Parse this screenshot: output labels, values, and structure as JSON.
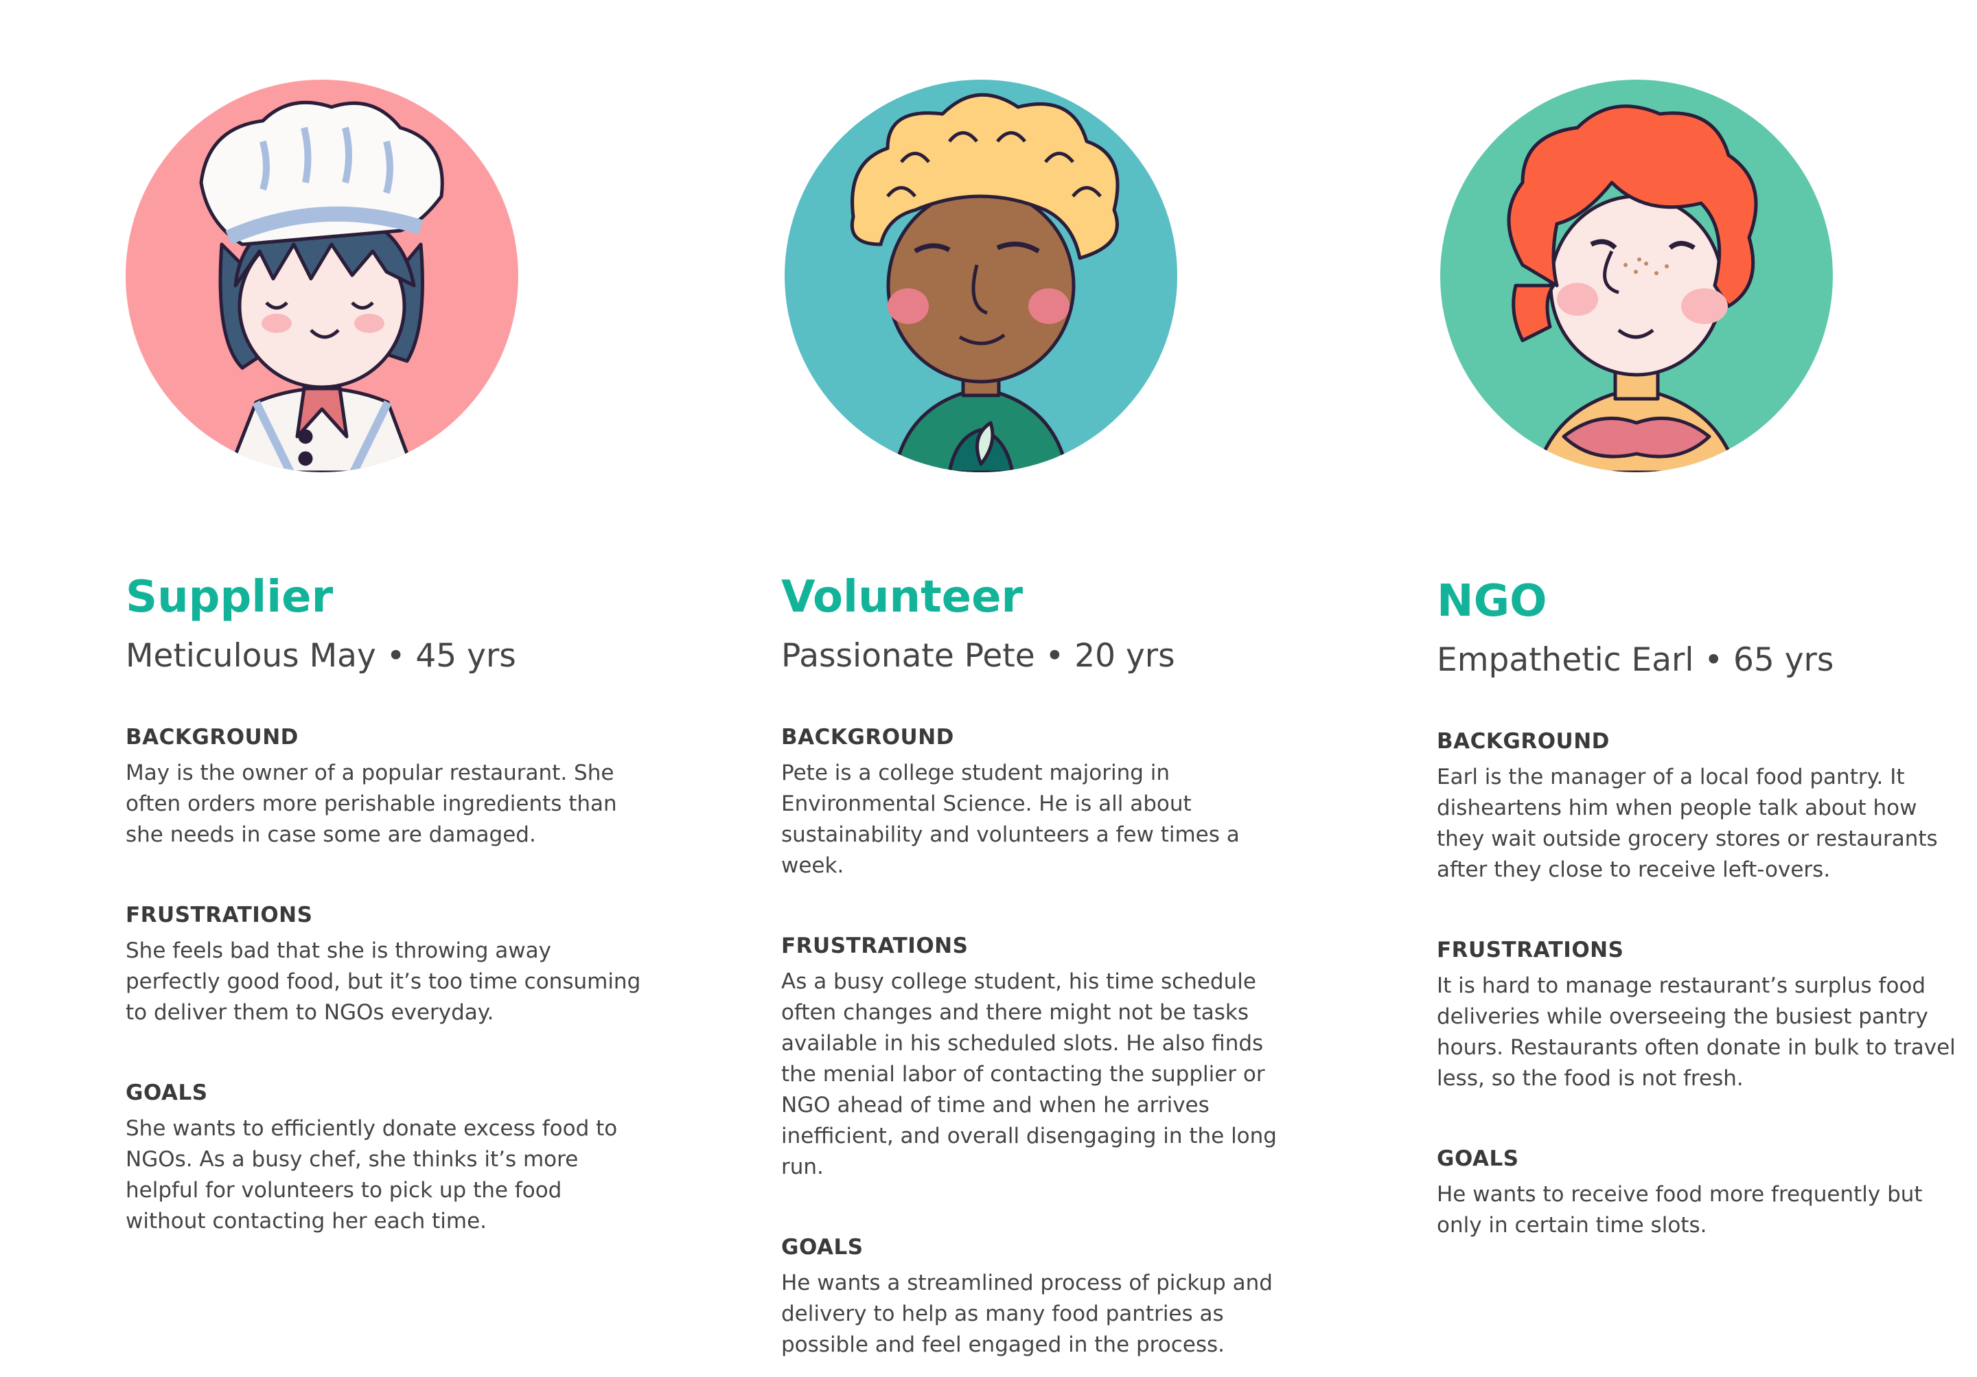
{
  "colors": {
    "accent": "#13b39a",
    "supplier_bg": "#fc9da2",
    "volunteer_bg": "#5abec5",
    "ngo_bg": "#5fc8aa",
    "body_text": "#444444",
    "outline": "#2a1e3a"
  },
  "personas": [
    {
      "role": "Supplier",
      "persona": "Meticulous May • 45 yrs",
      "avatar_icon": "chef-avatar-icon",
      "sections": [
        {
          "heading": "BACKGROUND",
          "text": "May is the owner of a popular restaurant. She often orders more perishable ingredients than she needs in case some are damaged."
        },
        {
          "heading": "FRUSTRATIONS",
          "text": "She feels bad that she is throwing away perfectly good food, but it’s too time consuming to deliver them to NGOs everyday."
        },
        {
          "heading": "GOALS",
          "text": "She wants to efficiently donate excess food to NGOs. As a busy chef, she thinks it’s more helpful for volunteers to pick up the food without contacting her each time."
        }
      ]
    },
    {
      "role": "Volunteer",
      "persona": "Passionate Pete • 20 yrs",
      "avatar_icon": "volunteer-avatar-icon",
      "sections": [
        {
          "heading": "BACKGROUND",
          "text": "Pete is a college student majoring in Environmental Science. He is all about sustainability and volunteers a few times a week."
        },
        {
          "heading": "FRUSTRATIONS",
          "text": "As a busy college student, his time schedule often changes and there might not be tasks available in his scheduled slots. He also finds the menial labor of contacting the supplier or NGO ahead of time and when he arrives inefficient, and overall disengaging in the long run."
        },
        {
          "heading": "GOALS",
          "text": "He wants a streamlined process of pickup and delivery to help as many food pantries as possible and feel engaged in the process."
        }
      ]
    },
    {
      "role": "NGO",
      "persona": "Empathetic Earl • 65 yrs",
      "avatar_icon": "ngo-avatar-icon",
      "sections": [
        {
          "heading": "BACKGROUND",
          "text": "Earl is the manager of a local food pantry. It disheartens him when people talk about how they wait outside grocery stores or restaurants after they close to receive left-overs."
        },
        {
          "heading": "FRUSTRATIONS",
          "text": "It is hard to manage restaurant’s surplus food deliveries while overseeing the busiest pantry hours. Restaurants often donate in bulk to travel less, so the food is not fresh."
        },
        {
          "heading": "GOALS",
          "text": "He wants to receive food more frequently but only in certain time slots."
        }
      ]
    }
  ]
}
